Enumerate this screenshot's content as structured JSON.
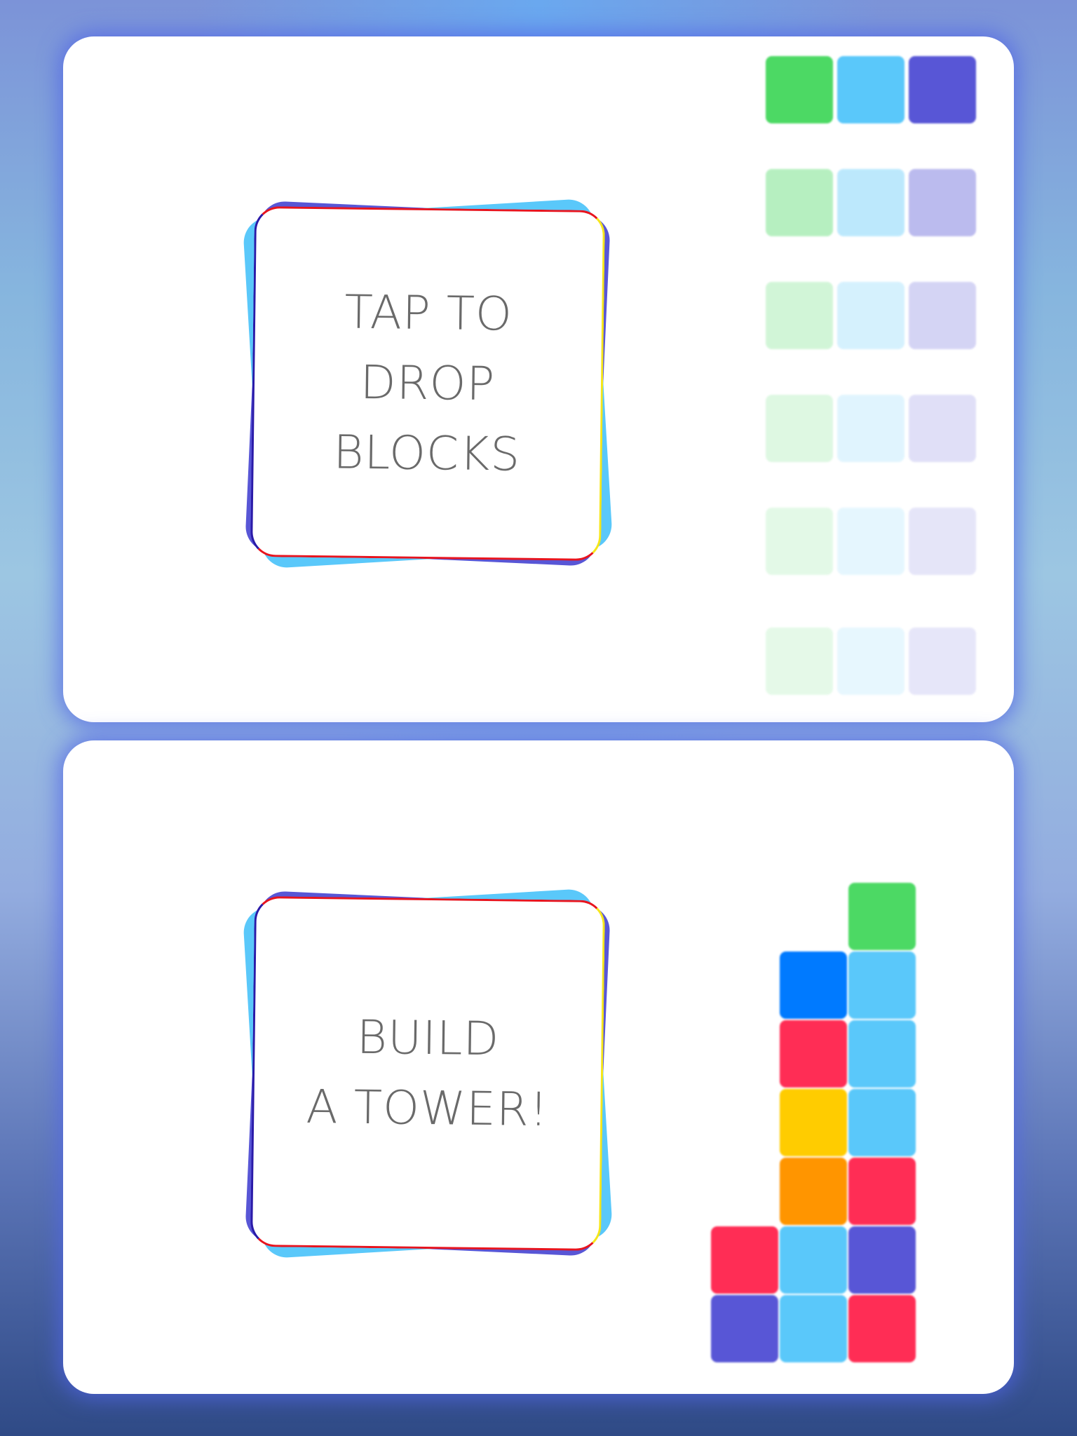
{
  "panels": [
    {
      "card_lines": [
        "TAP TO",
        "DROP",
        "BLOCKS"
      ]
    },
    {
      "card_lines": [
        "BUILD",
        "A TOWER!"
      ]
    }
  ],
  "colors": {
    "green": "#4cd964",
    "sky": "#5ac8fa",
    "indigo": "#5856d6",
    "blue": "#007aff",
    "red": "#ff2d55",
    "yellow": "#ffcc00",
    "orange": "#ff9500"
  },
  "block_rows_top": [
    {
      "colors": [
        "green",
        "sky",
        "indigo"
      ],
      "opacity": 1.0
    },
    {
      "colors": [
        "green",
        "sky",
        "indigo"
      ],
      "opacity": 0.4
    },
    {
      "colors": [
        "green",
        "sky",
        "indigo"
      ],
      "opacity": 0.25
    },
    {
      "colors": [
        "green",
        "sky",
        "indigo"
      ],
      "opacity": 0.18
    },
    {
      "colors": [
        "green",
        "sky",
        "indigo"
      ],
      "opacity": 0.15
    },
    {
      "colors": [
        "green",
        "sky",
        "indigo"
      ],
      "opacity": 0.14
    }
  ],
  "tower_rows": [
    [
      null,
      null,
      "green"
    ],
    [
      null,
      "blue",
      "sky"
    ],
    [
      null,
      "red",
      "sky"
    ],
    [
      null,
      "yellow",
      "sky"
    ],
    [
      null,
      "orange",
      "red"
    ],
    [
      "red",
      "sky",
      "indigo"
    ],
    [
      "indigo",
      "sky",
      "red"
    ]
  ]
}
